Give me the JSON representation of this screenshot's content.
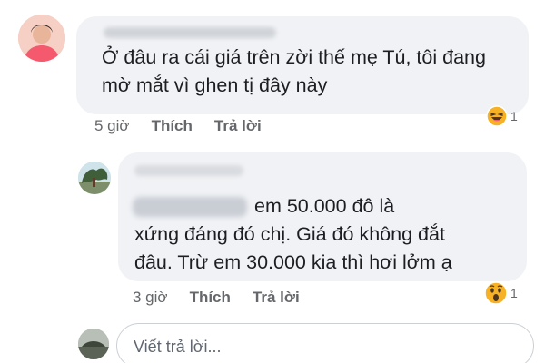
{
  "comments": [
    {
      "text": "Ở đâu ra cái giá trên zời thế mẹ Tú, tôi đang mờ mắt vì ghen tị đây này",
      "time": "5 giờ",
      "like_label": "Thích",
      "reply_label": "Trả lời",
      "reaction": {
        "icon": "laughing-emoji-icon",
        "count": "1"
      }
    },
    {
      "reply": true,
      "text_lines": [
        "em 50.000 đô là",
        "xứng đáng đó chị. Giá đó không đắt",
        "đâu. Trừ em 30.000 kia thì hơi lởm ạ"
      ],
      "time": "3 giờ",
      "like_label": "Thích",
      "reply_label": "Trả lời",
      "reaction": {
        "icon": "wow-emoji-icon",
        "count": "1"
      }
    }
  ],
  "compose": {
    "placeholder": "Viết trả lời..."
  },
  "colors": {
    "bubble": "#f0f2f5",
    "meta": "#65676b",
    "reaction": "#f7b125"
  }
}
